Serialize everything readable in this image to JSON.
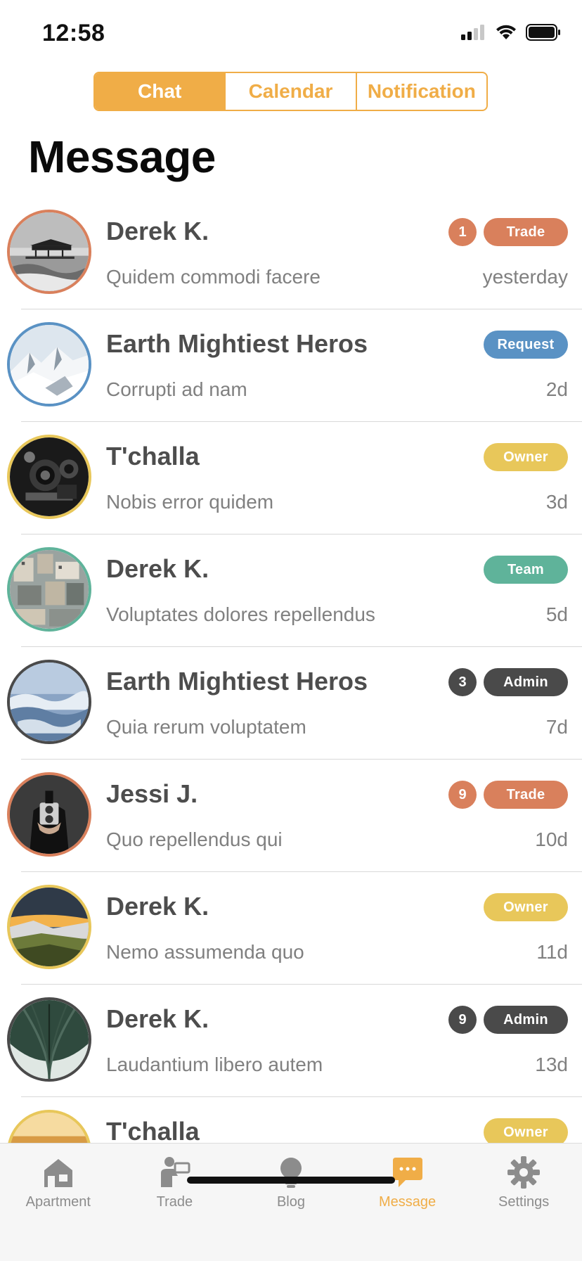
{
  "status": {
    "time": "12:58"
  },
  "segments": [
    {
      "label": "Chat",
      "active": true
    },
    {
      "label": "Calendar",
      "active": false
    },
    {
      "label": "Notification",
      "active": false
    }
  ],
  "page_title": "Message",
  "colors": {
    "accent": "#f0ad47",
    "trade": "#d9805c",
    "request": "#5a92c4",
    "owner": "#e8c75a",
    "team": "#5fb39a",
    "admin": "#4a4a4a"
  },
  "messages": [
    {
      "name": "Derek K.",
      "preview": "Quidem commodi facere",
      "time": "yesterday",
      "count": "1",
      "tag": "Trade",
      "tag_color": "#d9805c",
      "avatar": "pier-photo"
    },
    {
      "name": "Earth Mightiest Heros",
      "preview": "Corrupti ad nam",
      "time": "2d",
      "count": "",
      "tag": "Request",
      "tag_color": "#5a92c4",
      "avatar": "snowy-mountain-photo"
    },
    {
      "name": "T'challa",
      "preview": "Nobis error quidem",
      "time": "3d",
      "count": "",
      "tag": "Owner",
      "tag_color": "#e8c75a",
      "avatar": "camera-photo"
    },
    {
      "name": "Derek K.",
      "preview": "Voluptates dolores repellendus",
      "time": "5d",
      "count": "",
      "tag": "Team",
      "tag_color": "#5fb39a",
      "avatar": "city-photo"
    },
    {
      "name": "Earth Mightiest Heros",
      "preview": "Quia rerum voluptatem",
      "time": "7d",
      "count": "3",
      "tag": "Admin",
      "tag_color": "#4a4a4a",
      "avatar": "clouds-photo"
    },
    {
      "name": "Jessi J.",
      "preview": "Quo repellendus qui",
      "time": "10d",
      "count": "9",
      "tag": "Trade",
      "tag_color": "#d9805c",
      "avatar": "photographer-photo"
    },
    {
      "name": "Derek K.",
      "preview": "Nemo assumenda quo",
      "time": "11d",
      "count": "",
      "tag": "Owner",
      "tag_color": "#e8c75a",
      "avatar": "sunset-landscape-photo"
    },
    {
      "name": "Derek K.",
      "preview": "Laudantium libero autem",
      "time": "13d",
      "count": "9",
      "tag": "Admin",
      "tag_color": "#4a4a4a",
      "avatar": "bridge-photo"
    },
    {
      "name": "T'challa",
      "preview": "",
      "time": "",
      "count": "",
      "tag": "Owner",
      "tag_color": "#e8c75a",
      "avatar": "sunrise-photo"
    }
  ],
  "tabbar": [
    {
      "label": "Apartment",
      "icon": "house-icon",
      "active": false
    },
    {
      "label": "Trade",
      "icon": "trade-person-icon",
      "active": false
    },
    {
      "label": "Blog",
      "icon": "lightbulb-icon",
      "active": false
    },
    {
      "label": "Message",
      "icon": "chat-bubble-icon",
      "active": true
    },
    {
      "label": "Settings",
      "icon": "gear-icon",
      "active": false
    }
  ]
}
